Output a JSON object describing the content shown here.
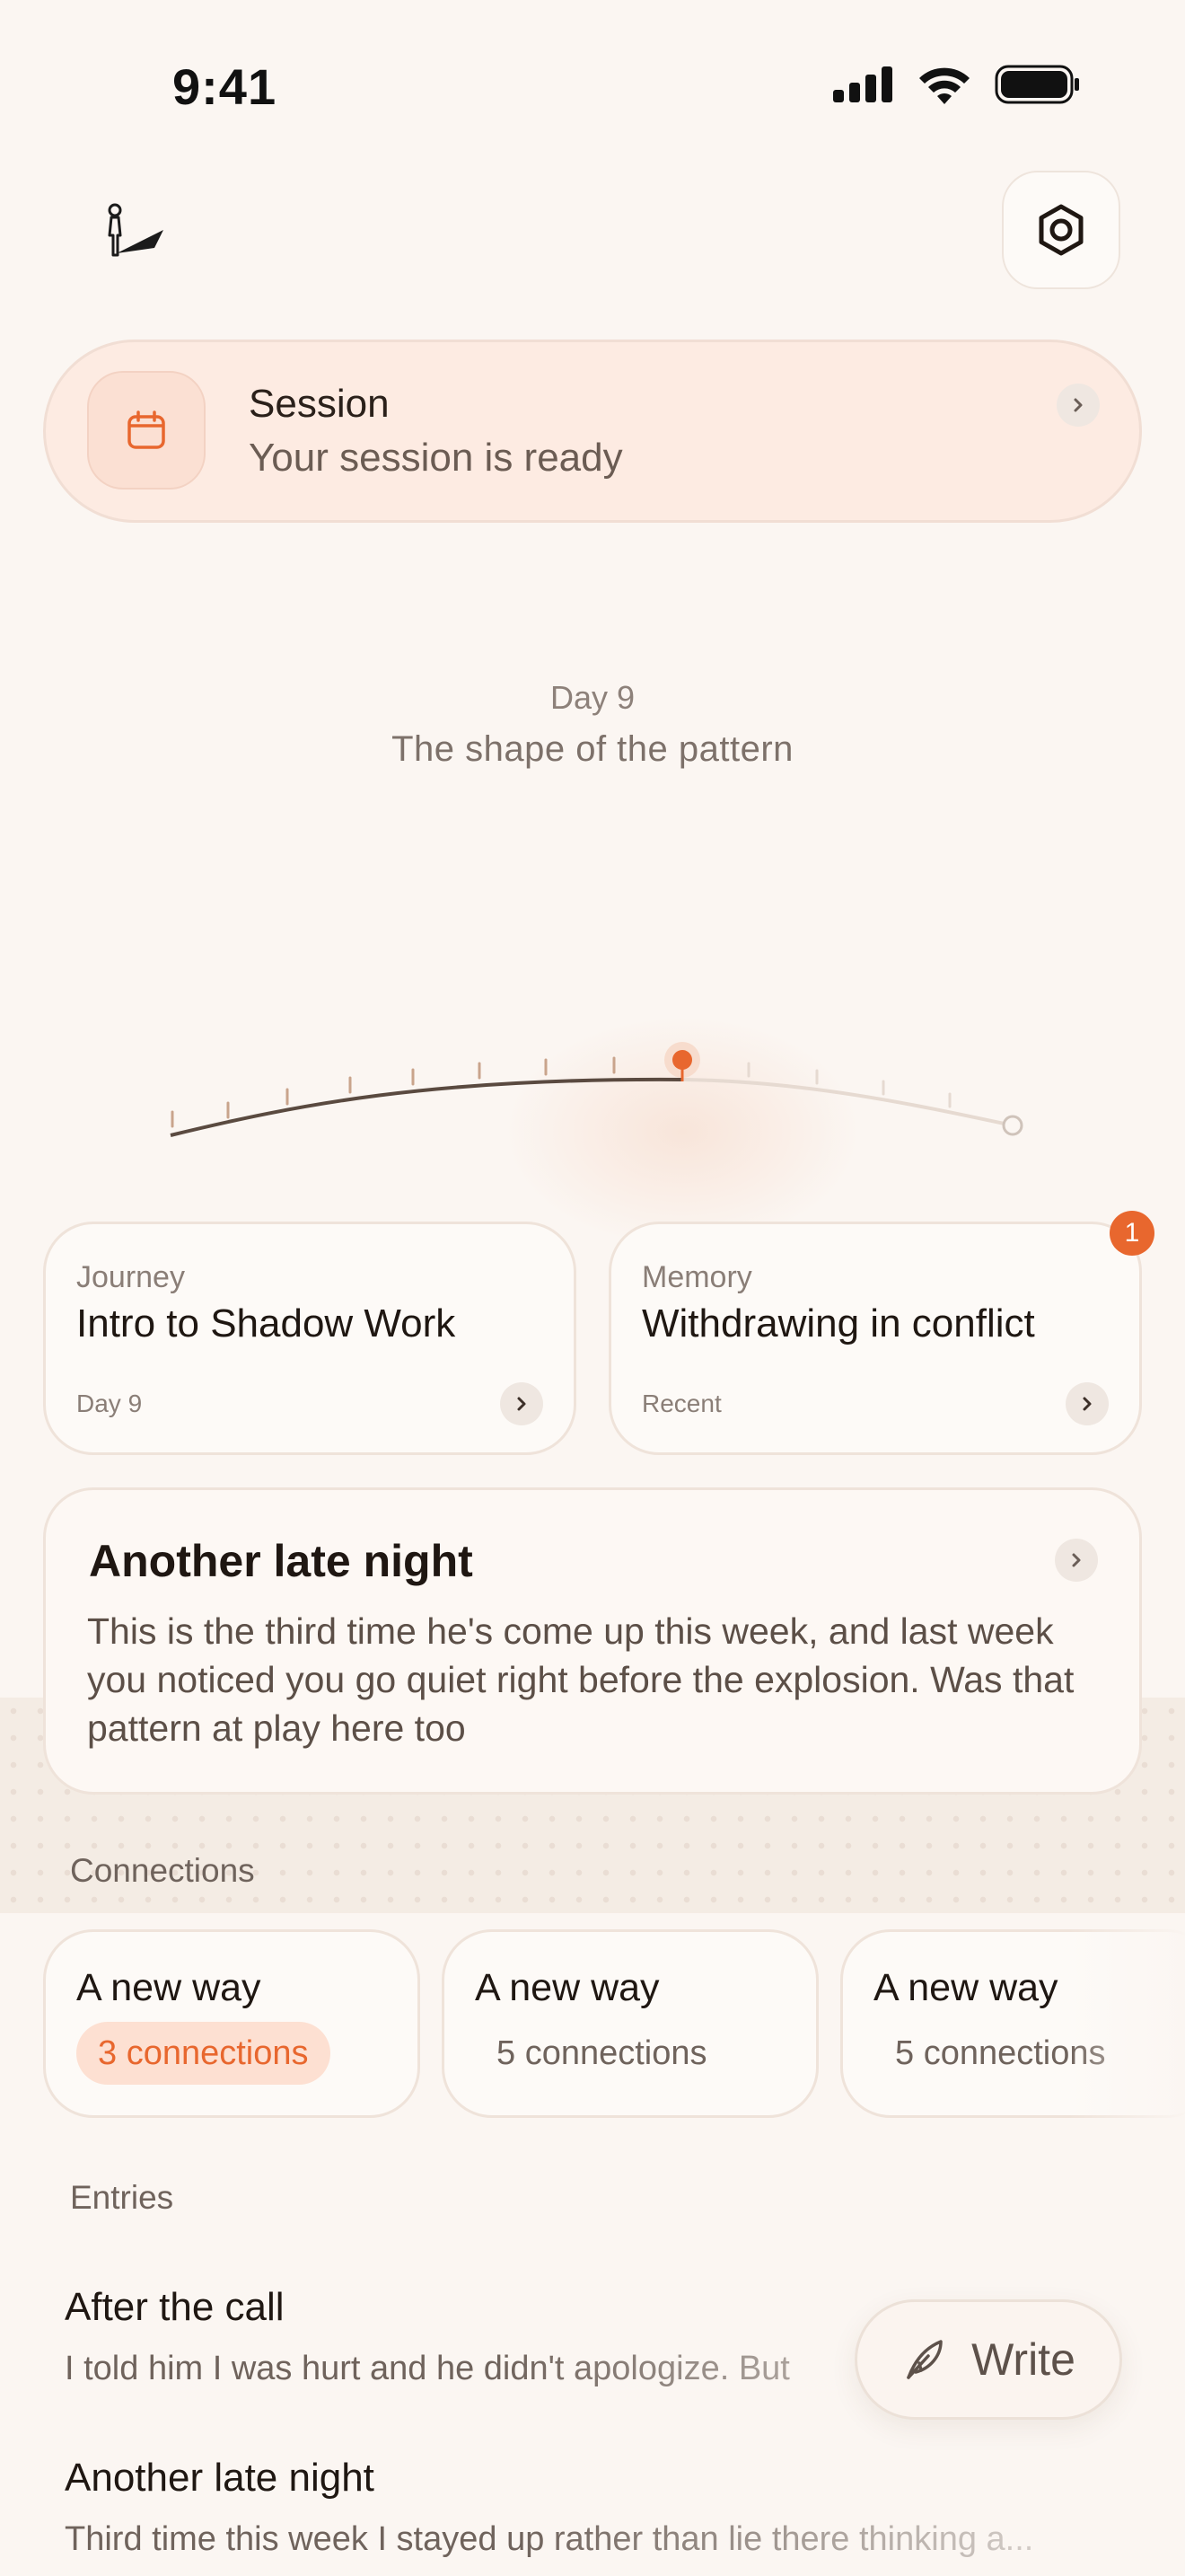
{
  "status_bar": {
    "time": "9:41"
  },
  "session": {
    "title": "Session",
    "subtitle": "Your session is ready"
  },
  "day": {
    "label": "Day 9",
    "subtitle": "The shape of the pattern"
  },
  "journey_card": {
    "kicker": "Journey",
    "title": "Intro to Shadow Work",
    "footer": "Day 9"
  },
  "memory_card": {
    "kicker": "Memory",
    "title": "Withdrawing in conflict",
    "footer": "Recent",
    "badge": "1"
  },
  "note_card": {
    "title": "Another late night",
    "body": "This is the third time he's come up this week, and last week you noticed you go quiet right before the explosion. Was that pattern at play here too"
  },
  "connections": {
    "label": "Connections",
    "items": [
      {
        "title": "A new way",
        "count": "3 connections",
        "active": true
      },
      {
        "title": "A new way",
        "count": "5 connections",
        "active": false
      },
      {
        "title": "A new way",
        "count": "5 connections",
        "active": false
      }
    ]
  },
  "entries": {
    "label": "Entries",
    "items": [
      {
        "title": "After the call",
        "body": "I told him I was hurt and he didn't apologize. But"
      },
      {
        "title": "Another late night",
        "body": "Third time this week I stayed up rather than lie there thinking a..."
      }
    ]
  },
  "write_button": {
    "label": "Write"
  },
  "colors": {
    "accent": "#e8672e",
    "background": "#fbf6f2",
    "session_card": "#fdebe2"
  },
  "icons": [
    "signal-icon",
    "wifi-icon",
    "battery-icon",
    "logo-figure-icon",
    "settings-icon",
    "calendar-icon",
    "chevron-right-icon",
    "feather-pen-icon"
  ]
}
